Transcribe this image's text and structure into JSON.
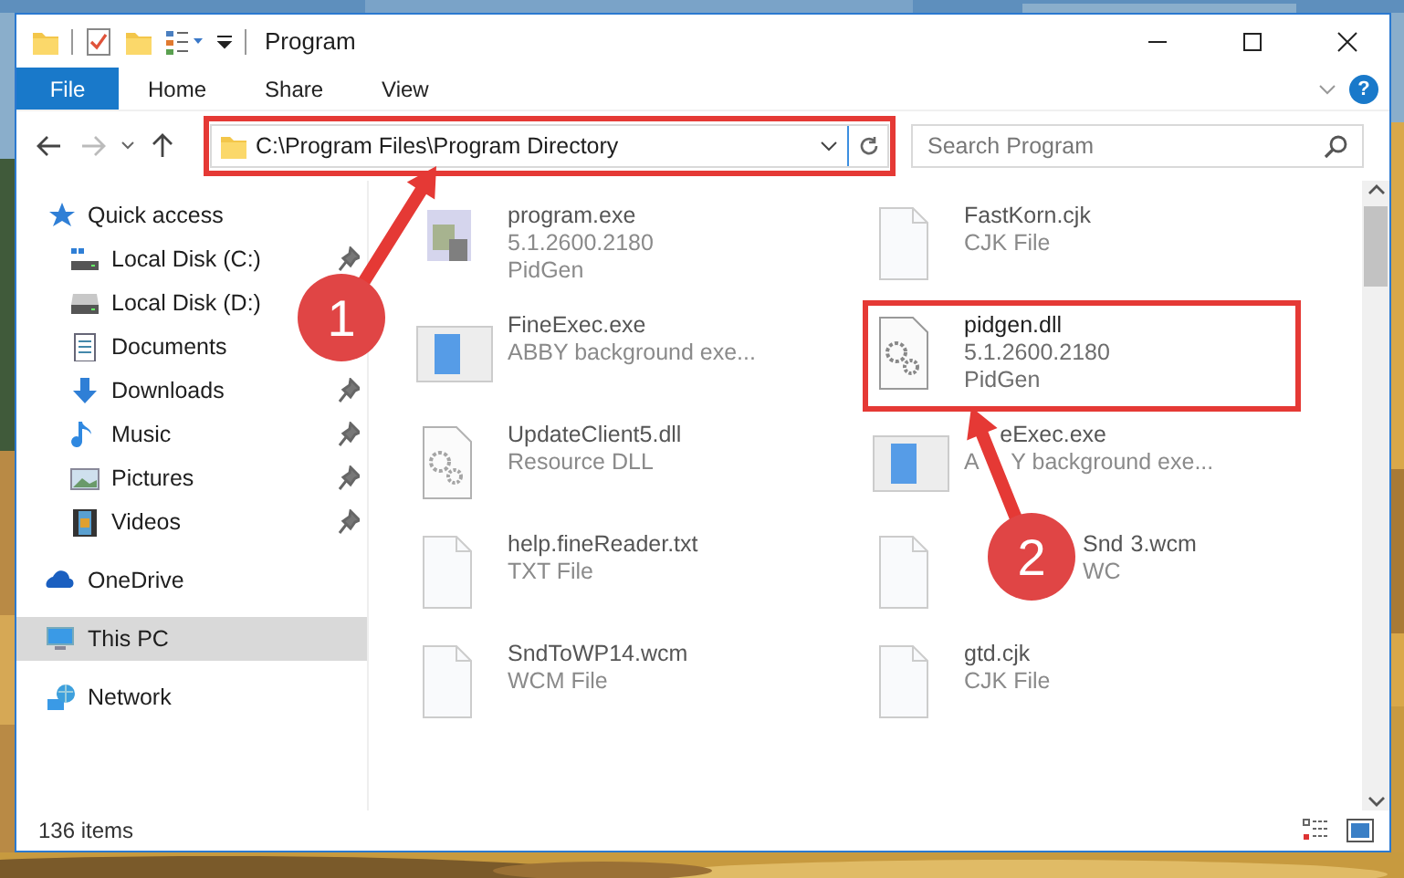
{
  "window": {
    "title": "Program"
  },
  "ribbon": {
    "tabs": [
      {
        "label": "File",
        "kind": "menu",
        "selected": false
      },
      {
        "label": "Home",
        "kind": "tab",
        "selected": false
      },
      {
        "label": "Share",
        "kind": "tab",
        "selected": false
      },
      {
        "label": "View",
        "kind": "tab",
        "selected": false
      }
    ],
    "help": "?"
  },
  "navigation": {
    "back_enabled": true,
    "forward_enabled": false
  },
  "address_bar": {
    "path": "C:\\Program Files\\Program Directory",
    "callout": "1"
  },
  "search": {
    "placeholder": "Search Program"
  },
  "sidebar": {
    "items": [
      {
        "label": "Quick access",
        "selected": false,
        "children": [
          {
            "label": "Local Disk (C:)",
            "pinned": true,
            "selected": false
          },
          {
            "label": "Local Disk (D:)",
            "selected": false
          },
          {
            "label": "Documents",
            "selected": false
          },
          {
            "label": "Downloads",
            "pinned": true,
            "selected": false
          },
          {
            "label": "Music",
            "pinned": true,
            "selected": false
          },
          {
            "label": "Pictures",
            "pinned": true,
            "selected": false
          },
          {
            "label": "Videos",
            "pinned": true,
            "selected": false
          }
        ]
      },
      {
        "label": "OneDrive",
        "selected": false
      },
      {
        "label": "This PC",
        "selected": true
      },
      {
        "label": "Network",
        "selected": false
      }
    ]
  },
  "files": [
    {
      "kind": "app",
      "name": [
        "program.exe"
      ],
      "details": [
        [
          "5.1.2600.2180"
        ],
        [
          "PidGen"
        ]
      ],
      "blurred": true
    },
    {
      "kind": "window",
      "name": [
        "FineExec.exe"
      ],
      "details": [
        [
          "ABBY background exe..."
        ]
      ],
      "blurred": true
    },
    {
      "kind": "gears",
      "name": [
        "UpdateClient5.dll"
      ],
      "details": [
        [
          "Resource DLL"
        ]
      ],
      "blurred": true
    },
    {
      "kind": "blank",
      "name": [
        "help.fineReader.txt"
      ],
      "details": [
        [
          "TXT File"
        ]
      ],
      "blurred": true
    },
    {
      "kind": "blank",
      "name": [
        "SndToWP14.wcm"
      ],
      "details": [
        [
          "WCM File"
        ]
      ],
      "blurred": true
    },
    {
      "kind": "blank",
      "name": [
        "FastKorn.cjk"
      ],
      "details": [
        [
          "CJK File"
        ]
      ],
      "blurred": true
    },
    {
      "kind": "gears",
      "name": [
        "pidgen.dll"
      ],
      "details": [
        [
          "5.1.2600.2180"
        ],
        [
          "PidGen"
        ]
      ],
      "blurred": false,
      "callout": "2"
    },
    {
      "kind": "window",
      "name": [
        "eExec.exe"
      ],
      "details": [
        [
          "A",
          "Y background exe..."
        ]
      ],
      "blurred": true
    },
    {
      "kind": "blank",
      "name": [
        "Snd",
        "3.wcm"
      ],
      "details": [
        [
          "WC"
        ]
      ],
      "blurred": true
    },
    {
      "kind": "blank",
      "name": [
        "gtd.cjk"
      ],
      "details": [
        [
          "CJK File"
        ]
      ],
      "blurred": true
    }
  ],
  "status_bar": {
    "item_count": "136 items"
  }
}
